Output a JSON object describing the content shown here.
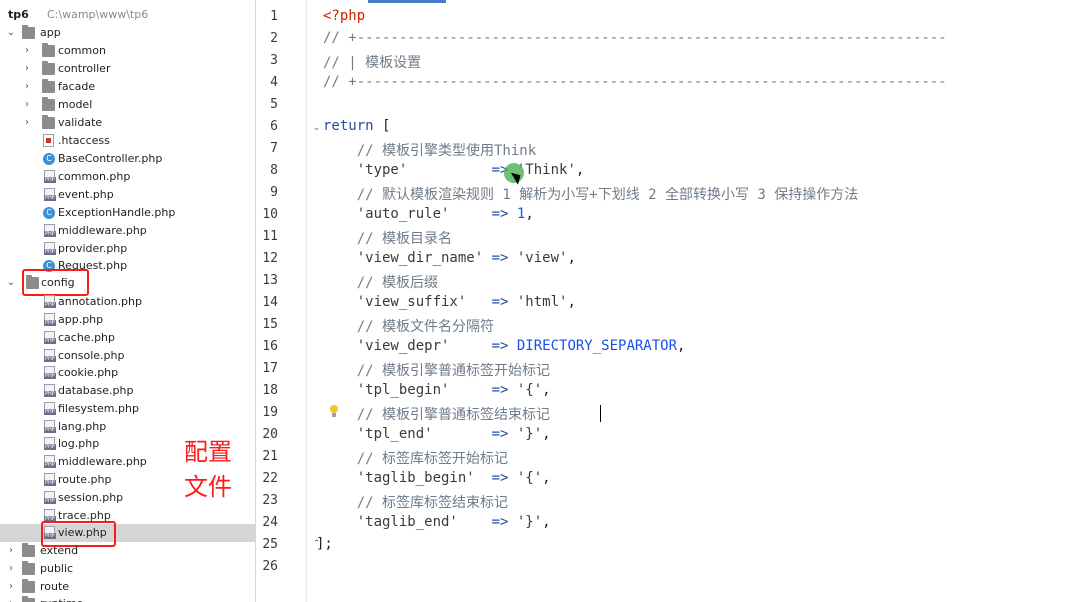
{
  "tree": {
    "root": {
      "name": "tp6",
      "path": "C:\\wamp\\www\\tp6"
    },
    "items": [
      {
        "label": "app"
      },
      {
        "label": "common"
      },
      {
        "label": "controller"
      },
      {
        "label": "facade"
      },
      {
        "label": "model"
      },
      {
        "label": "validate"
      },
      {
        "label": ".htaccess"
      },
      {
        "label": "BaseController.php"
      },
      {
        "label": "common.php"
      },
      {
        "label": "event.php"
      },
      {
        "label": "ExceptionHandle.php"
      },
      {
        "label": "middleware.php"
      },
      {
        "label": "provider.php"
      },
      {
        "label": "Request.php"
      },
      {
        "label": "config"
      },
      {
        "label": "annotation.php"
      },
      {
        "label": "app.php"
      },
      {
        "label": "cache.php"
      },
      {
        "label": "console.php"
      },
      {
        "label": "cookie.php"
      },
      {
        "label": "database.php"
      },
      {
        "label": "filesystem.php"
      },
      {
        "label": "lang.php"
      },
      {
        "label": "log.php"
      },
      {
        "label": "middleware.php"
      },
      {
        "label": "route.php"
      },
      {
        "label": "session.php"
      },
      {
        "label": "trace.php"
      },
      {
        "label": "view.php"
      },
      {
        "label": "extend"
      },
      {
        "label": "public"
      },
      {
        "label": "route"
      },
      {
        "label": "runtime"
      }
    ]
  },
  "annotation": "配置文件",
  "editor": {
    "line_numbers": [
      "1",
      "2",
      "3",
      "4",
      "5",
      "6",
      "7",
      "8",
      "9",
      "10",
      "11",
      "12",
      "13",
      "14",
      "15",
      "16",
      "17",
      "18",
      "19",
      "20",
      "21",
      "22",
      "23",
      "24",
      "25",
      "26"
    ],
    "lines": {
      "l1": "<?php",
      "l2": "// +----------------------------------------------------------------------",
      "l3": "// | 模板设置",
      "l4": "// +----------------------------------------------------------------------",
      "l6a": "return",
      "l6b": " [",
      "l7": "    // 模板引擎类型使用Think",
      "l8a": "    'type'",
      "l8b": "          => ",
      "l8c": "'Think'",
      "l8d": ",",
      "l9": "    // 默认模板渲染规则 1 解析为小写+下划线 2 全部转换小写 3 保持操作方法",
      "l10a": "    'auto_rule'",
      "l10b": "     => ",
      "l10c": "1",
      "l10d": ",",
      "l11": "    // 模板目录名",
      "l12a": "    'view_dir_name'",
      "l12b": " => ",
      "l12c": "'view'",
      "l12d": ",",
      "l13": "    // 模板后缀",
      "l14a": "    'view_suffix'",
      "l14b": "   => ",
      "l14c": "'html'",
      "l14d": ",",
      "l15": "    // 模板文件名分隔符",
      "l16a": "    'view_depr'",
      "l16b": "     => ",
      "l16c": "DIRECTORY_SEPARATOR",
      "l16d": ",",
      "l17": "    // 模板引擎普通标签开始标记",
      "l18a": "    'tpl_begin'",
      "l18b": "     => ",
      "l18c": "'{'",
      "l18d": ",",
      "l19": "    // 模板引擎普通标签结束标记",
      "l20a": "    'tpl_end'",
      "l20b": "       => ",
      "l20c": "'}'",
      "l20d": ",",
      "l21": "    // 标签库标签开始标记",
      "l22a": "    'taglib_begin'",
      "l22b": "  => ",
      "l22c": "'{'",
      "l22d": ",",
      "l23": "    // 标签库标签结束标记",
      "l24a": "    'taglib_end'",
      "l24b": "    => ",
      "l24c": "'}'",
      "l24d": ",",
      "l25": "];"
    }
  }
}
